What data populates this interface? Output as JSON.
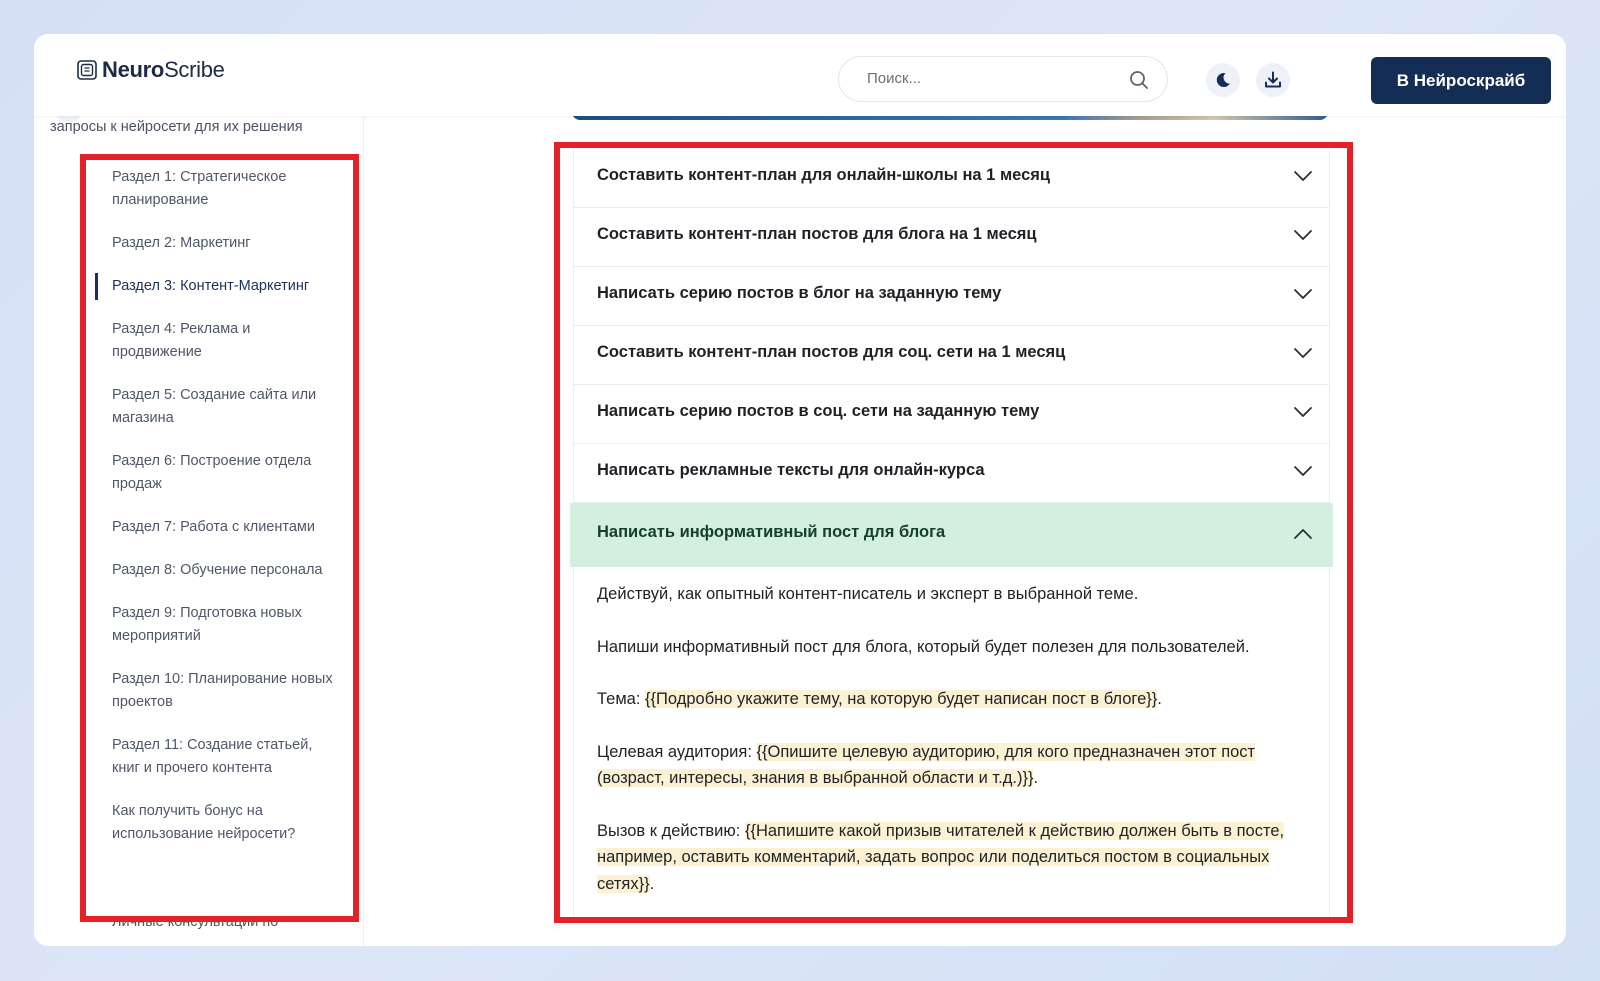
{
  "header": {
    "logo_bold": "Neuro",
    "logo_light": "Scribe",
    "search_placeholder": "Поиск...",
    "cta_label": "В Нейроскрайб"
  },
  "sidebar": {
    "partial_text": "запросы к нейросети для их решения",
    "items": [
      {
        "label": "Раздел 1: Стратегическое планирование"
      },
      {
        "label": "Раздел 2: Маркетинг"
      },
      {
        "label": "Раздел 3: Контент-Маркетинг"
      },
      {
        "label": "Раздел 4: Реклама и продвижение"
      },
      {
        "label": "Раздел 5: Создание сайта или магазина"
      },
      {
        "label": "Раздел 6: Построение отдела продаж"
      },
      {
        "label": "Раздел 7: Работа с клиентами"
      },
      {
        "label": "Раздел 8: Обучение персонала"
      },
      {
        "label": "Раздел 9: Подготовка новых мероприятий"
      },
      {
        "label": "Раздел 10: Планирование новых проектов"
      },
      {
        "label": "Раздел 11: Создание статьей, книг и прочего контента"
      },
      {
        "label": "Как получить бонус на использование нейросети?"
      }
    ],
    "active_index": 2,
    "cut_item": "Личные консультации по"
  },
  "accordion": {
    "items": [
      {
        "title": "Составить контент-план для онлайн-школы на 1 месяц"
      },
      {
        "title": "Составить контент-план постов для блога на 1 месяц"
      },
      {
        "title": "Написать серию постов в блог на заданную тему"
      },
      {
        "title": "Составить контент-план постов для соц. сети на 1 месяц"
      },
      {
        "title": "Написать серию постов в соц. сети на заданную тему"
      },
      {
        "title": "Написать рекламные тексты для онлайн-курса"
      },
      {
        "title": "Написать информативный пост для блога"
      }
    ],
    "open_index": 6,
    "body": {
      "p1": "Действуй, как опытный контент-писатель и эксперт в выбранной теме.",
      "p2": "Напиши информативный пост для блога, который будет полезен для пользователей.",
      "topic_label": "Тема: ",
      "topic_value": "{{Подробно укажите тему, на которую будет написан пост в блоге}}",
      "audience_label": "Целевая аудитория: ",
      "audience_value": "{{Опишите целевую аудиторию, для кого предназначен этот пост (возраст, интересы, знания в выбранной области и т.д.)}}",
      "cta_label": "Вызов к действию: ",
      "cta_value": "{{Напишите какой призыв читателей к действию должен быть в посте, например, оставить комментарий, задать вопрос или поделиться постом в социальных сетях}}",
      "end": "."
    }
  },
  "colors": {
    "brand_navy": "#132d54",
    "open_item_bg": "#d3efe0",
    "placeholder_highlight": "#fcf1d3",
    "annotation_red": "#e42127"
  },
  "icons": [
    "logo-icon",
    "search-icon",
    "moon-icon",
    "download-icon",
    "chevron-down-icon",
    "chevron-up-icon"
  ]
}
